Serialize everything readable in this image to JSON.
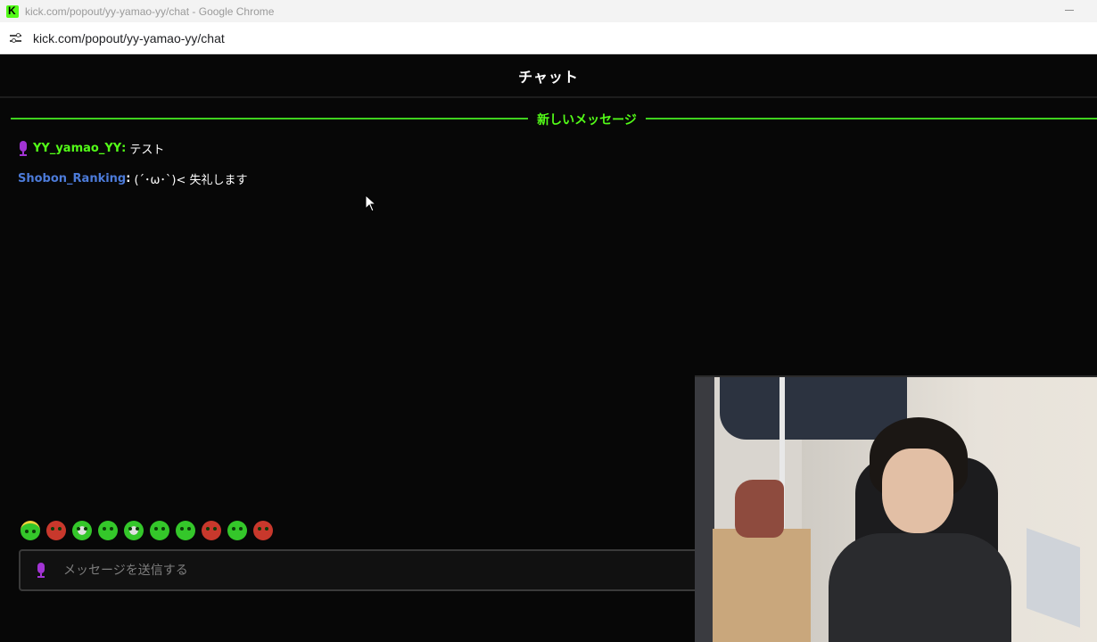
{
  "window": {
    "title": "kick.com/popout/yy-yamao-yy/chat - Google Chrome",
    "url": "kick.com/popout/yy-yamao-yy/chat"
  },
  "chat": {
    "header_title": "チャット",
    "new_messages_label": "新しいメッセージ",
    "messages": [
      {
        "username": "YY_yamao_YY",
        "text": "テスト",
        "badge": "mic-icon",
        "color": "#53fc18"
      },
      {
        "username": "Shobon_Ranking",
        "text": "(´･ω･`)< 失礼します",
        "color": "#4c7bd9"
      }
    ],
    "input_placeholder": "メッセージを送信する",
    "emotes": [
      "halo-emote",
      "angry-emote",
      "glasses-emote",
      "smile-emote",
      "chef-emote",
      "grin-emote",
      "wave-emote",
      "hat-emote",
      "think-emote",
      "love-emote"
    ]
  },
  "colors": {
    "accent": "#53fc18",
    "background": "#070707"
  }
}
